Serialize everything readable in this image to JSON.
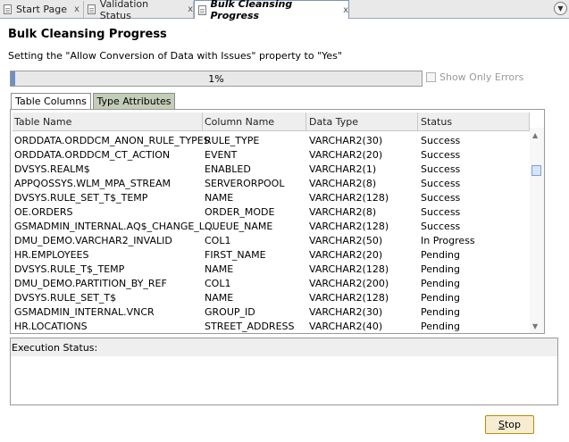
{
  "editor_tabs": [
    {
      "label": "Start Page",
      "close": "x",
      "active": false
    },
    {
      "label": "Validation Status",
      "close": "x",
      "active": false
    },
    {
      "label": "Bulk Cleansing Progress",
      "close": "x",
      "active": true
    }
  ],
  "title": "Bulk Cleansing Progress",
  "subtitle": "Setting the \"Allow Conversion of Data with Issues\" property to \"Yes\"",
  "progress": {
    "percent_label": "1%",
    "value": 0.01
  },
  "show_only_errors": {
    "label": "Show Only Errors",
    "checked": false,
    "enabled": false
  },
  "sub_tabs": [
    "Table Columns",
    "Type Attributes"
  ],
  "table": {
    "columns": [
      "Table Name",
      "Column Name",
      "Data Type",
      "Status"
    ],
    "rows": [
      [
        "ORDDATA.ORDDCM_ANON_RULE_TYPES",
        "RULE_TYPE",
        "VARCHAR2(30)",
        "Success"
      ],
      [
        "ORDDATA.ORDDCM_CT_ACTION",
        "EVENT",
        "VARCHAR2(20)",
        "Success"
      ],
      [
        "DVSYS.REALM$",
        "ENABLED",
        "VARCHAR2(1)",
        "Success"
      ],
      [
        "APPQOSSYS.WLM_MPA_STREAM",
        "SERVERORPOOL",
        "VARCHAR2(8)",
        "Success"
      ],
      [
        "DVSYS.RULE_SET_T$_TEMP",
        "NAME",
        "VARCHAR2(128)",
        "Success"
      ],
      [
        "OE.ORDERS",
        "ORDER_MODE",
        "VARCHAR2(8)",
        "Success"
      ],
      [
        "GSMADMIN_INTERNAL.AQ$_CHANGE_L...",
        "QUEUE_NAME",
        "VARCHAR2(128)",
        "Success"
      ],
      [
        "DMU_DEMO.VARCHAR2_INVALID",
        "COL1",
        "VARCHAR2(50)",
        "In Progress"
      ],
      [
        "HR.EMPLOYEES",
        "FIRST_NAME",
        "VARCHAR2(20)",
        "Pending"
      ],
      [
        "DVSYS.RULE_T$_TEMP",
        "NAME",
        "VARCHAR2(128)",
        "Pending"
      ],
      [
        "DMU_DEMO.PARTITION_BY_REF",
        "COL1",
        "VARCHAR2(200)",
        "Pending"
      ],
      [
        "DVSYS.RULE_SET_T$",
        "NAME",
        "VARCHAR2(128)",
        "Pending"
      ],
      [
        "GSMADMIN_INTERNAL.VNCR",
        "GROUP_ID",
        "VARCHAR2(30)",
        "Pending"
      ],
      [
        "HR.LOCATIONS",
        "STREET_ADDRESS",
        "VARCHAR2(40)",
        "Pending"
      ]
    ]
  },
  "execution_status": {
    "label": "Execution Status:",
    "value": ""
  },
  "stop_button": {
    "mnemonic": "S",
    "rest": "top"
  },
  "icons": {
    "tab_doc": "document-icon",
    "close": "close-icon",
    "dropdown": "chevron-down-icon"
  },
  "colors": {
    "progress_fill": "#6f8ec7",
    "tab_selected_border": "#7d95b8",
    "inactive_subtab": "#c3cdb7",
    "stop_border": "#b98c00"
  }
}
